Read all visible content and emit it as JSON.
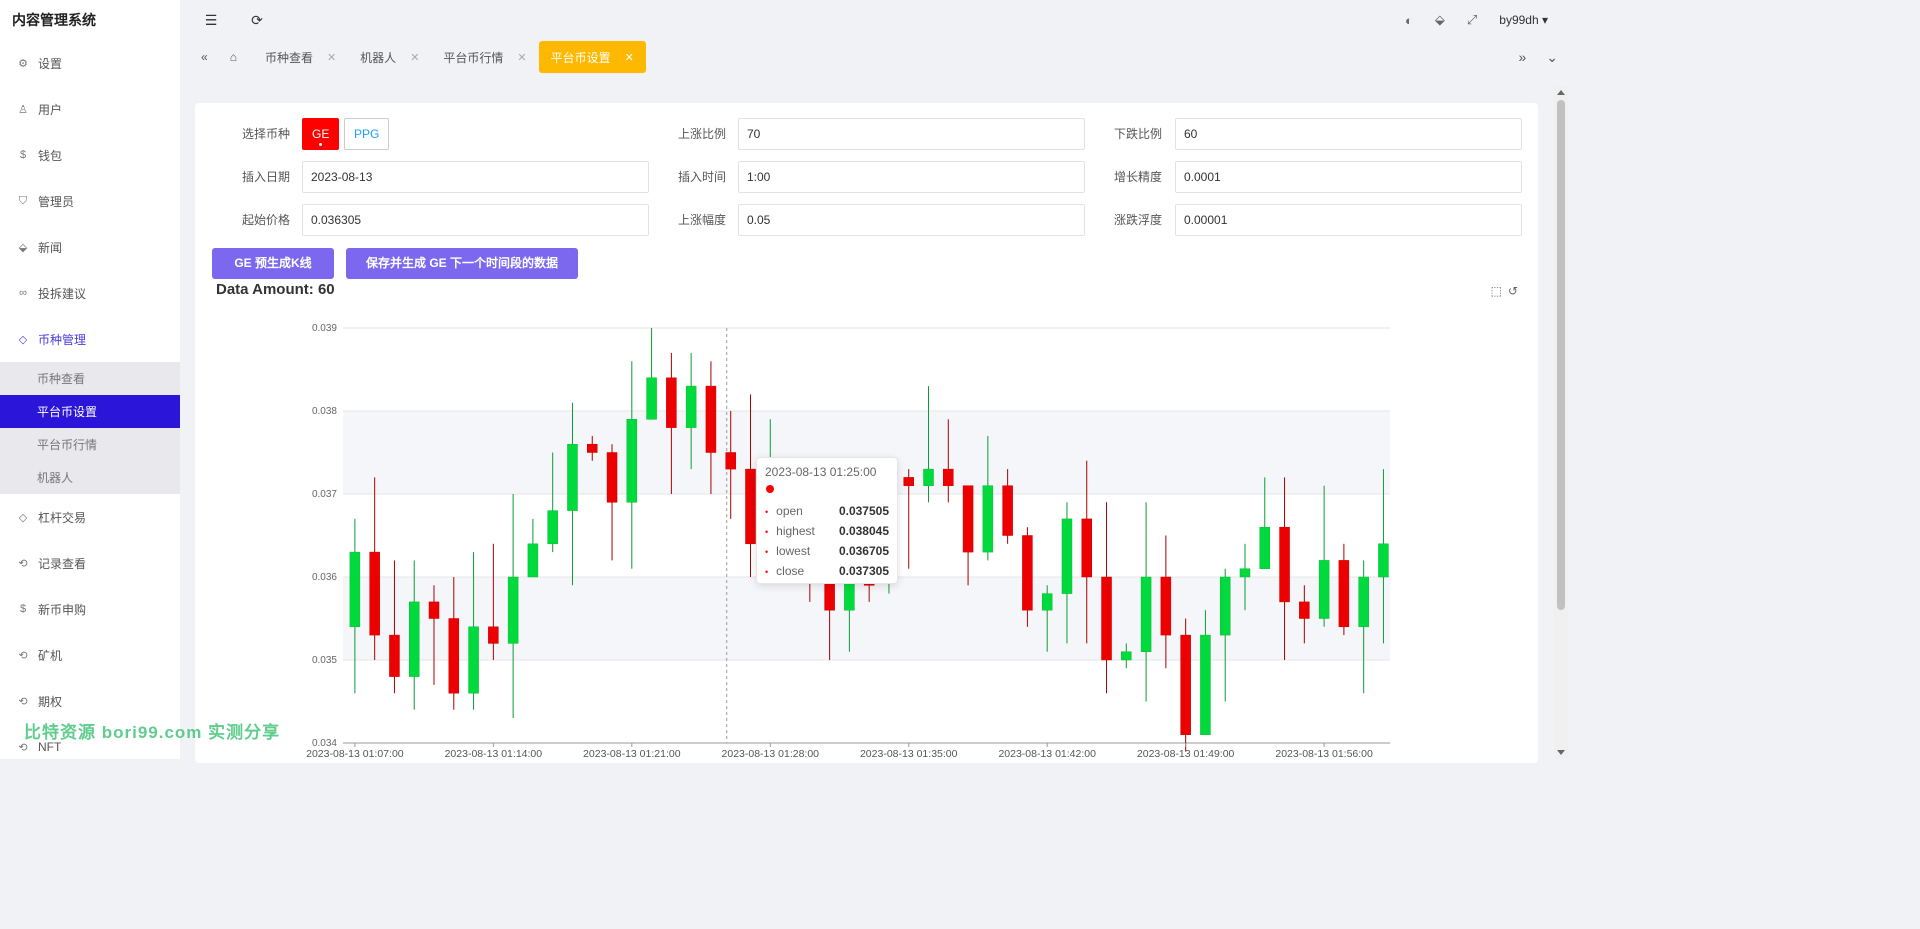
{
  "app": {
    "title": "内容管理系统"
  },
  "sidebar": {
    "items": [
      {
        "label": "设置",
        "icon": "gear-icon"
      },
      {
        "label": "用户",
        "icon": "user-icon"
      },
      {
        "label": "钱包",
        "icon": "dollar-icon"
      },
      {
        "label": "管理员",
        "icon": "shield-icon"
      },
      {
        "label": "新闻",
        "icon": "tag-icon"
      },
      {
        "label": "投拆建议",
        "icon": "link-icon"
      }
    ],
    "active_group": {
      "label": "币种管理",
      "icon": "diamond-icon"
    },
    "sub_items": [
      {
        "label": "币种查看"
      },
      {
        "label": "平台币设置"
      },
      {
        "label": "平台币行情"
      },
      {
        "label": "机器人"
      }
    ],
    "items_after": [
      {
        "label": "杠杆交易",
        "icon": "diamond-icon"
      },
      {
        "label": "记录查看",
        "icon": "circle-arrow-icon"
      },
      {
        "label": "新币申购",
        "icon": "dollar-icon"
      },
      {
        "label": "矿机",
        "icon": "circle-arrow-icon"
      },
      {
        "label": "期权",
        "icon": "circle-arrow-icon"
      },
      {
        "label": "NFT",
        "icon": "circle-arrow-icon"
      }
    ]
  },
  "header": {
    "user": "by99dh ▾",
    "icons": [
      "menu-fold-icon",
      "refresh-icon",
      "palette-icon",
      "tag-icon",
      "fullscreen-icon"
    ]
  },
  "tabs": {
    "items": [
      {
        "label": "币种查看"
      },
      {
        "label": "机器人"
      },
      {
        "label": "平台币行情"
      },
      {
        "label": "平台币设置"
      }
    ]
  },
  "form": {
    "coin_label": "选择币种",
    "coins": [
      "GE",
      "PPG"
    ],
    "up_ratio_label": "上涨比例",
    "up_ratio": "70",
    "down_ratio_label": "下跌比例",
    "down_ratio": "60",
    "insert_date_label": "插入日期",
    "insert_date": "2023-08-13",
    "insert_time_label": "插入时间",
    "insert_time": "1:00",
    "precision_label": "增长精度",
    "precision": "0.0001",
    "start_price_label": "起始价格",
    "start_price": "0.036305",
    "up_range_label": "上涨幅度",
    "up_range": "0.05",
    "float_label": "涨跌浮度",
    "float": "0.00001",
    "btn_generate": "GE 预生成K线",
    "btn_save": "保存并生成 GE 下一个时间段的数据"
  },
  "data_amount": "Data Amount: 60",
  "watermark": "比特资源 bori99.com 实测分享",
  "tooltip": {
    "time": "2023-08-13 01:25:00",
    "rows": [
      {
        "k": "open",
        "v": "0.037505"
      },
      {
        "k": "highest",
        "v": "0.038045"
      },
      {
        "k": "lowest",
        "v": "0.036705"
      },
      {
        "k": "close",
        "v": "0.037305"
      }
    ]
  },
  "colors": {
    "up": "#00da3c",
    "down": "#ec0000",
    "accent": "#2b15d9",
    "tab_active": "#ffb800",
    "button": "#7b68ee"
  },
  "chart_data": {
    "type": "candlestick",
    "ylim": [
      0.034,
      0.039
    ],
    "yticks": [
      "0.039",
      "0.038",
      "0.037",
      "0.036",
      "0.035",
      "0.034"
    ],
    "xtick_labels": [
      "2023-08-13 01:07:00",
      "2023-08-13 01:14:00",
      "2023-08-13 01:21:00",
      "2023-08-13 01:28:00",
      "2023-08-13 01:35:00",
      "2023-08-13 01:42:00",
      "2023-08-13 01:49:00",
      "2023-08-13 01:56:00"
    ],
    "xtick_index": [
      0,
      7,
      14,
      21,
      28,
      35,
      42,
      49
    ],
    "hover_index": 19,
    "candles": [
      [
        0.0354,
        0.0363,
        0.0346,
        0.0367
      ],
      [
        0.0363,
        0.0353,
        0.035,
        0.0372
      ],
      [
        0.0353,
        0.0348,
        0.0346,
        0.0362
      ],
      [
        0.0348,
        0.0357,
        0.0344,
        0.0362
      ],
      [
        0.0357,
        0.0355,
        0.0347,
        0.0359
      ],
      [
        0.0355,
        0.0346,
        0.0344,
        0.036
      ],
      [
        0.0346,
        0.0354,
        0.0344,
        0.0363
      ],
      [
        0.0354,
        0.0352,
        0.035,
        0.0364
      ],
      [
        0.0352,
        0.036,
        0.0343,
        0.037
      ],
      [
        0.036,
        0.0364,
        0.036,
        0.0367
      ],
      [
        0.0364,
        0.0368,
        0.0363,
        0.0375
      ],
      [
        0.0368,
        0.0376,
        0.0359,
        0.0381
      ],
      [
        0.0376,
        0.0375,
        0.0374,
        0.0377
      ],
      [
        0.0375,
        0.0369,
        0.0362,
        0.0376
      ],
      [
        0.0369,
        0.0379,
        0.0361,
        0.0386
      ],
      [
        0.0379,
        0.0384,
        0.038,
        0.039
      ],
      [
        0.0384,
        0.0378,
        0.037,
        0.0387
      ],
      [
        0.0378,
        0.0383,
        0.0373,
        0.0387
      ],
      [
        0.0383,
        0.0375,
        0.037,
        0.0386
      ],
      [
        0.0375,
        0.0373,
        0.0367,
        0.038
      ],
      [
        0.0373,
        0.0364,
        0.036,
        0.0382
      ],
      [
        0.0364,
        0.0368,
        0.0362,
        0.0379
      ],
      [
        0.0368,
        0.0366,
        0.036,
        0.0374
      ],
      [
        0.0366,
        0.0363,
        0.0357,
        0.0373
      ],
      [
        0.0366,
        0.0356,
        0.035,
        0.0369
      ],
      [
        0.0356,
        0.0363,
        0.0351,
        0.0367
      ],
      [
        0.036,
        0.0359,
        0.0357,
        0.0366
      ],
      [
        0.0364,
        0.0372,
        0.0358,
        0.0373
      ],
      [
        0.0372,
        0.0371,
        0.0361,
        0.0373
      ],
      [
        0.0371,
        0.0373,
        0.0369,
        0.0383
      ],
      [
        0.0373,
        0.0371,
        0.0369,
        0.0379
      ],
      [
        0.0371,
        0.0363,
        0.0359,
        0.0371
      ],
      [
        0.0363,
        0.0371,
        0.0362,
        0.0377
      ],
      [
        0.0371,
        0.0365,
        0.0364,
        0.0373
      ],
      [
        0.0365,
        0.0356,
        0.0354,
        0.0366
      ],
      [
        0.0356,
        0.0358,
        0.0351,
        0.0359
      ],
      [
        0.0358,
        0.0367,
        0.0352,
        0.0369
      ],
      [
        0.0367,
        0.036,
        0.0352,
        0.0374
      ],
      [
        0.036,
        0.035,
        0.0346,
        0.0369
      ],
      [
        0.035,
        0.0351,
        0.0349,
        0.0352
      ],
      [
        0.0351,
        0.036,
        0.0345,
        0.0369
      ],
      [
        0.036,
        0.0353,
        0.0349,
        0.0365
      ],
      [
        0.0353,
        0.0341,
        0.0339,
        0.0355
      ],
      [
        0.0341,
        0.0353,
        0.0342,
        0.0356
      ],
      [
        0.0353,
        0.036,
        0.0345,
        0.0361
      ],
      [
        0.036,
        0.0361,
        0.0356,
        0.0364
      ],
      [
        0.0361,
        0.0366,
        0.0361,
        0.0372
      ],
      [
        0.0366,
        0.0357,
        0.035,
        0.0372
      ],
      [
        0.0357,
        0.0355,
        0.0352,
        0.0359
      ],
      [
        0.0355,
        0.0362,
        0.0354,
        0.0371
      ],
      [
        0.0362,
        0.0354,
        0.0353,
        0.0364
      ],
      [
        0.0354,
        0.036,
        0.0346,
        0.0362
      ],
      [
        0.036,
        0.0364,
        0.0352,
        0.0373
      ]
    ]
  }
}
